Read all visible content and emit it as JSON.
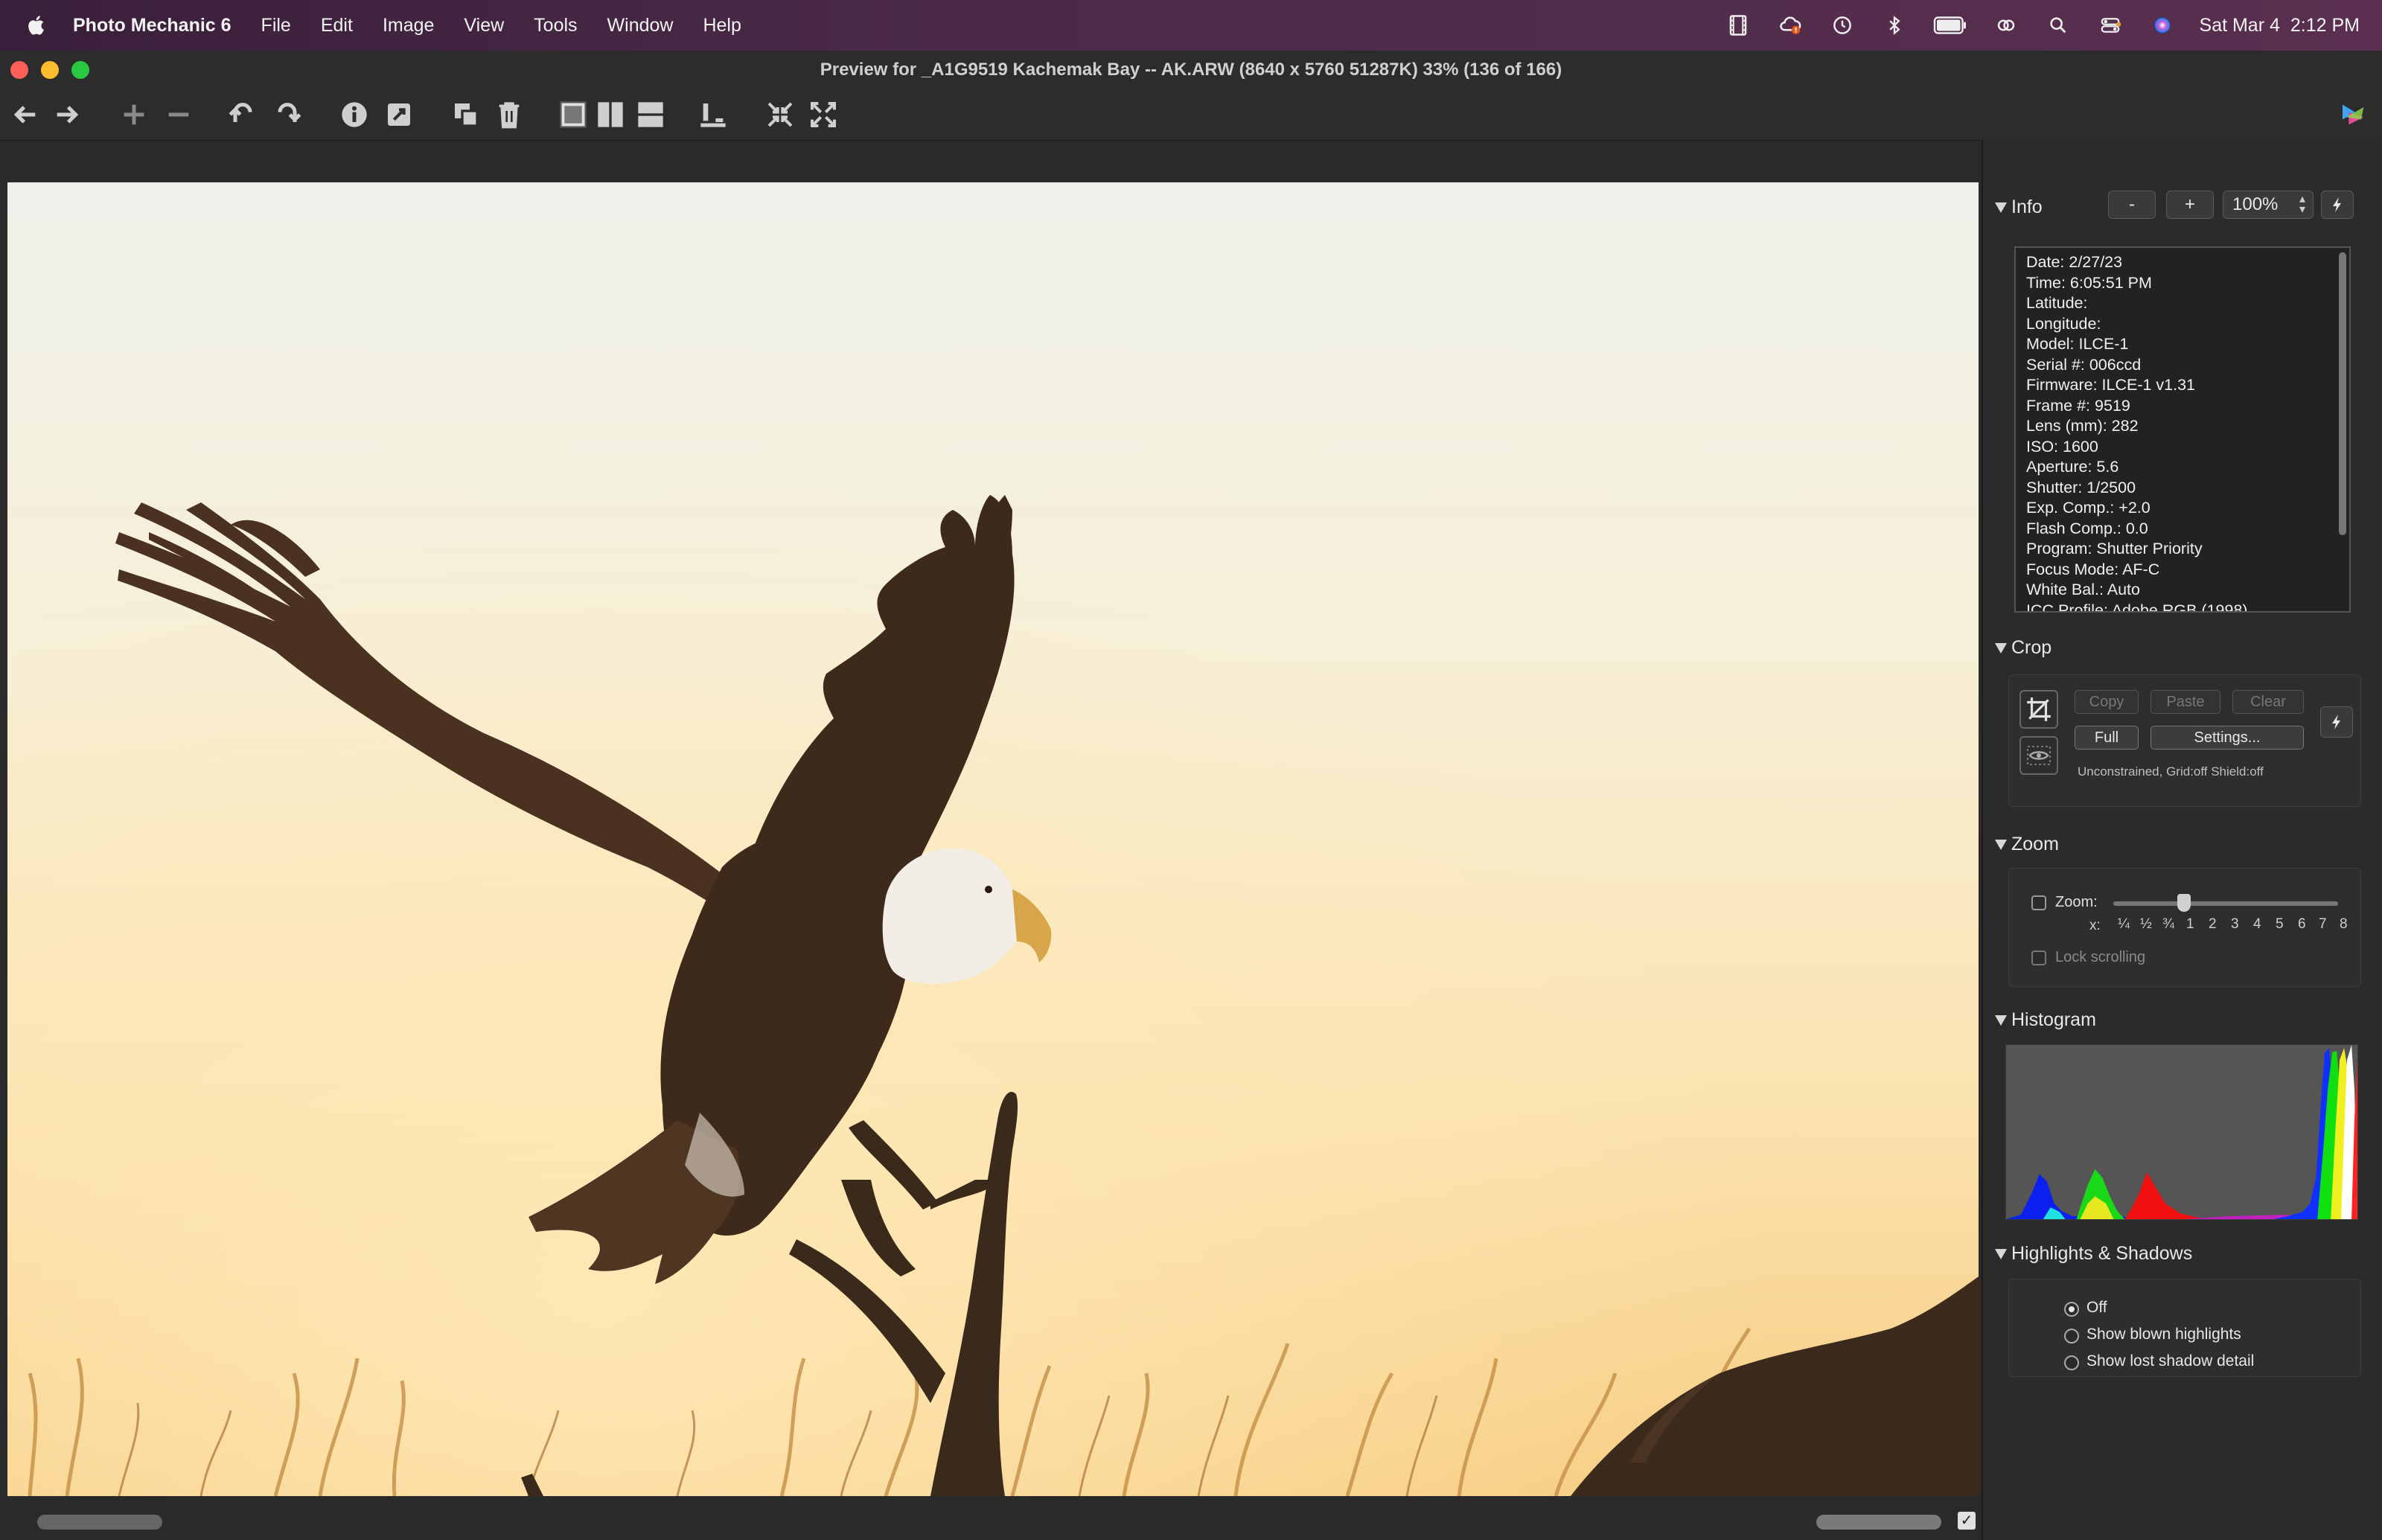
{
  "menubar": {
    "app_name": "Photo Mechanic 6",
    "items": [
      "File",
      "Edit",
      "Image",
      "View",
      "Tools",
      "Window",
      "Help"
    ],
    "date": "Sat Mar 4",
    "time": "2:12 PM"
  },
  "window": {
    "title": "Preview for _A1G9519  Kachemak Bay -- AK.ARW (8640 x 5760 51287K) 33% (136 of 166)"
  },
  "info": {
    "header": "Info",
    "minus_label": "-",
    "plus_label": "+",
    "zoom_value": "100%",
    "lines": [
      "Date: 2/27/23",
      "Time: 6:05:51 PM",
      "Latitude:",
      "Longitude:",
      "Model: ILCE-1",
      "Serial #: 006ccd",
      "Firmware: ILCE-1 v1.31",
      "Frame #: 9519",
      "Lens (mm): 282",
      "ISO: 1600",
      "Aperture: 5.6",
      "Shutter: 1/2500",
      "Exp. Comp.: +2.0",
      "Flash Comp.: 0.0",
      "Program: Shutter Priority",
      "Focus Mode: AF-C",
      "White Bal.: Auto",
      "ICC Profile: Adobe RGB (1998)"
    ]
  },
  "crop": {
    "header": "Crop",
    "copy_label": "Copy",
    "paste_label": "Paste",
    "clear_label": "Clear",
    "full_label": "Full",
    "settings_label": "Settings...",
    "status": "Unconstrained, Grid:off Shield:off"
  },
  "zoom": {
    "header": "Zoom",
    "zoom_label": "Zoom:",
    "x_label": "x:",
    "ticks": [
      "¼",
      "½",
      "¾",
      "1",
      "2",
      "3",
      "4",
      "5",
      "6",
      "7",
      "8"
    ],
    "lock_label": "Lock scrolling"
  },
  "histogram": {
    "header": "Histogram"
  },
  "highlights": {
    "header": "Highlights & Shadows",
    "options": [
      "Off",
      "Show blown highlights",
      "Show lost shadow detail"
    ],
    "selected": "Off"
  },
  "colors": {
    "menubar": "#4a2a48",
    "panel": "#2b2b2b",
    "sky": "#f7ecd4"
  }
}
